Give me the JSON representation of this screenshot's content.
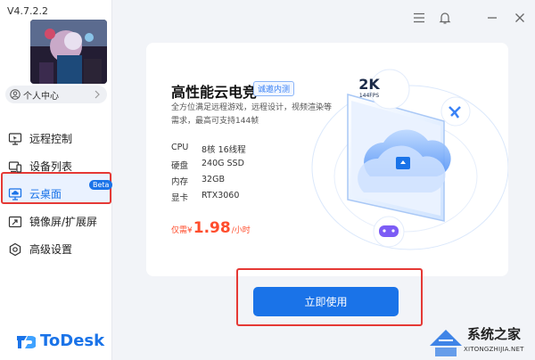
{
  "app": {
    "version": "V4.7.2.2",
    "brand": "ToDesk"
  },
  "sidebar": {
    "user_center_label": "个人中心",
    "items": [
      {
        "label": "远程控制",
        "icon": "monitor-icon"
      },
      {
        "label": "设备列表",
        "icon": "devices-icon"
      },
      {
        "label": "云桌面",
        "icon": "cloud-desktop-icon",
        "badge": "Beta",
        "active": true
      },
      {
        "label": "镜像屏/扩展屏",
        "icon": "screen-mirror-icon"
      },
      {
        "label": "高级设置",
        "icon": "gear-icon"
      }
    ]
  },
  "card": {
    "title": "高性能云电竞",
    "tag": "诚邀内测",
    "description": "全方位满足远程游戏，远程设计，视频渲染等需求，最高可支持144帧",
    "specs": [
      {
        "key": "CPU",
        "value": "8核 16线程"
      },
      {
        "key": "硬盘",
        "value": "240G SSD"
      },
      {
        "key": "内存",
        "value": "32GB"
      },
      {
        "key": "显卡",
        "value": "RTX3060"
      }
    ],
    "price": {
      "prefix": "仅需",
      "currency": "¥",
      "amount": "1.98",
      "unit": "/小时"
    },
    "badge_2k": "2K",
    "badge_fps": "144FPS"
  },
  "action": {
    "use_label": "立即使用"
  },
  "watermark": {
    "title": "系统之家",
    "url": "XITONGZHIJIA.NET"
  },
  "colors": {
    "accent": "#1a73e8",
    "price": "#ff4d2d",
    "highlight_border": "#e53935"
  }
}
